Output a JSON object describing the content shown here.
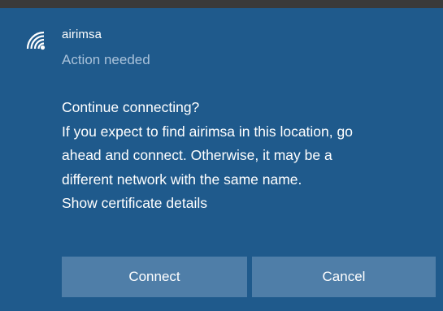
{
  "network": {
    "name": "airimsa",
    "status": "Action needed",
    "icon": "wifi-secured-icon"
  },
  "message": {
    "title": "Continue connecting?",
    "body_lines": [
      "If you expect to find airimsa in this location, go",
      "ahead and connect. Otherwise, it may be a",
      "different network with the same name."
    ],
    "link": "Show certificate details"
  },
  "buttons": {
    "connect": "Connect",
    "cancel": "Cancel"
  },
  "colors": {
    "panel_background": "#1f5a8c",
    "button_background": "#4f7ea8",
    "status_text": "#a9c2da",
    "top_bar": "#3a3a3a"
  }
}
